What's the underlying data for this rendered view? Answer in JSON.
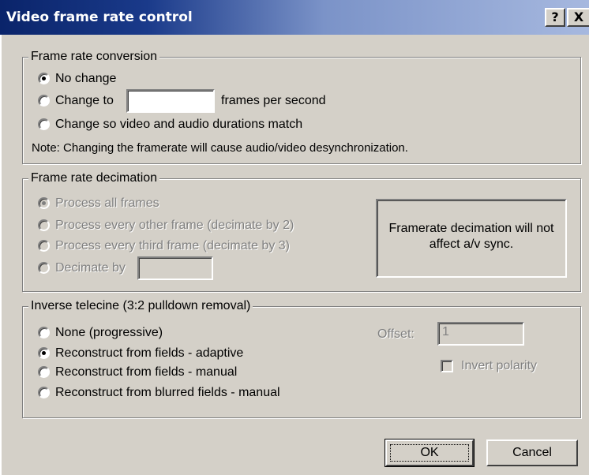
{
  "window": {
    "title": "Video frame rate control",
    "help_button": "?",
    "close_button": "X"
  },
  "conversion": {
    "group_label": "Frame rate conversion",
    "options": [
      "No change",
      "Change to",
      "Change so video and audio durations match"
    ],
    "selected_index": 0,
    "fps_value": "",
    "fps_suffix": "frames per second",
    "note": "Note: Changing the framerate will cause audio/video desynchronization."
  },
  "decimation": {
    "group_label": "Frame rate decimation",
    "options": [
      "Process all frames",
      "Process every other frame (decimate by 2)",
      "Process every third frame (decimate by 3)",
      "Decimate by"
    ],
    "selected_index": 0,
    "decimate_value": "",
    "info_text_line1": "Framerate decimation will not",
    "info_text_line2": "affect a/v sync."
  },
  "telecine": {
    "group_label": "Inverse telecine (3:2 pulldown removal)",
    "options": [
      "None (progressive)",
      "Reconstruct from fields - adaptive",
      "Reconstruct from fields - manual",
      "Reconstruct from blurred fields - manual"
    ],
    "selected_index": 1,
    "offset_label": "Offset:",
    "offset_value": "1",
    "invert_label": "Invert polarity",
    "invert_checked": false
  },
  "buttons": {
    "ok": "OK",
    "cancel": "Cancel"
  }
}
